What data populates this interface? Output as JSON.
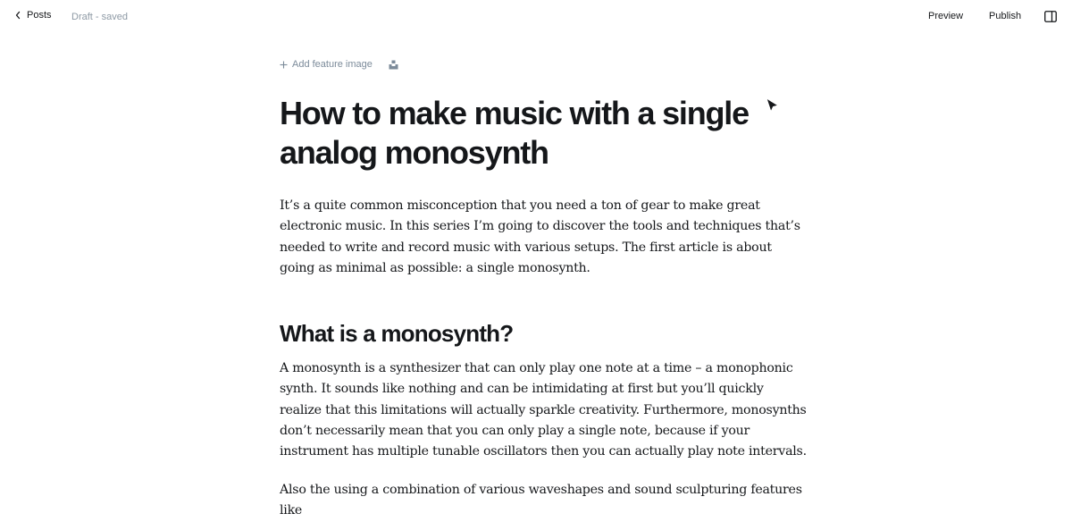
{
  "topbar": {
    "back_label": "Posts",
    "status": "Draft - saved",
    "preview_label": "Preview",
    "publish_label": "Publish",
    "icons": {
      "back": "chevron-left-icon",
      "sidebar": "sidebar-toggle-icon"
    }
  },
  "editor": {
    "add_feature_label": "Add feature image",
    "icons": {
      "add": "plus-icon",
      "unsplash": "unsplash-icon"
    },
    "title_lines": [
      "How to make music with a single",
      "analog monosynth"
    ],
    "paragraph1": "It’s a quite common misconception that you need a ton of gear to make great electronic music. In this series I’m going to discover the tools and techniques that’s needed to write and record music with various setups. The first article is about going as minimal as possible: a single monosynth.",
    "heading2": "What is a monosynth?",
    "paragraph2": "A monosynth is a synthesizer that can only play one note at a time – a monophonic synth. It sounds like nothing and can be intimidating at first but you’ll quickly realize that this limitations will actually sparkle creativity. Furthermore, monosynths don’t necessarily mean that you can only play a single note, because if your instrument has multiple tunable oscillators then you can actually play note intervals.",
    "paragraph3": "Also the using a combination of various waveshapes and sound sculpturing features like"
  },
  "colors": {
    "text": "#15171a",
    "muted": "#8e9aa5",
    "background": "#ffffff"
  }
}
